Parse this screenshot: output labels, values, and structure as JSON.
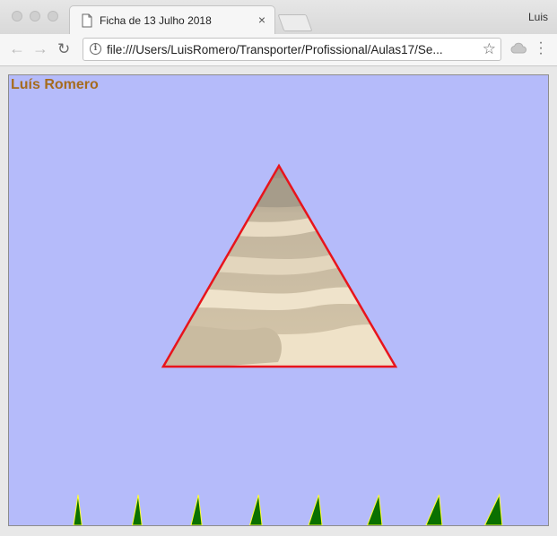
{
  "browser": {
    "tab_title": "Ficha de 13 Julho 2018",
    "tab_close": "×",
    "profile_name": "Luis",
    "url": "file:///Users/LuisRomero/Transporter/Profissional/Aulas17/Se...",
    "icons": {
      "back": "arrow-left-icon",
      "forward": "arrow-right-icon",
      "reload": "reload-icon",
      "info": "info-icon",
      "bookmark": "star-icon",
      "extension": "cloud-icon",
      "menu": "kebab-menu-icon",
      "tab": "document-icon"
    }
  },
  "page": {
    "author": "Luís Romero",
    "colors": {
      "background": "#b5bbfa",
      "author_text": "#a66c1e",
      "triangle_stroke": "#e8141c",
      "spike_fill": "#0a7000",
      "spike_stroke": "#ffff33"
    },
    "spike_count": 8
  }
}
